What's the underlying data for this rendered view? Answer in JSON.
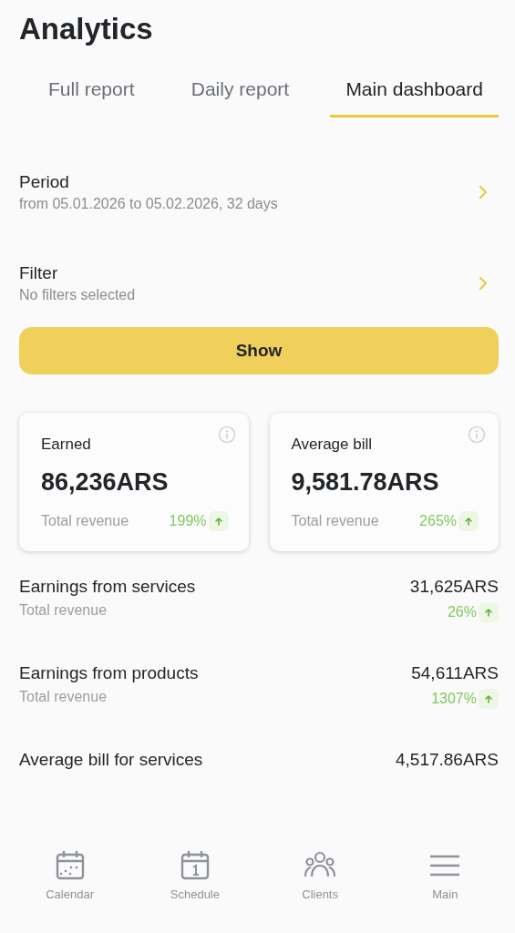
{
  "title": "Analytics",
  "tabs": [
    {
      "label": "Full report",
      "selected": false
    },
    {
      "label": "Daily report",
      "selected": false
    },
    {
      "label": "Main dashboard",
      "selected": true
    }
  ],
  "settings": [
    {
      "label": "Period",
      "value": "from 05.01.2026 to 05.02.2026, 32 days"
    },
    {
      "label": "Filter",
      "value": "No filters selected"
    }
  ],
  "show_button": "Show",
  "cards": [
    {
      "label": "Earned",
      "value": "86,236ARS",
      "caption": "Total revenue",
      "change": "199%"
    },
    {
      "label": "Average bill",
      "value": "9,581.78ARS",
      "caption": "Total revenue",
      "change": "265%"
    }
  ],
  "metrics": [
    {
      "label": "Earnings from services",
      "value": "31,625ARS",
      "caption": "Total revenue",
      "change": "26%"
    },
    {
      "label": "Earnings from products",
      "value": "54,611ARS",
      "caption": "Total revenue",
      "change": "1307%"
    },
    {
      "label": "Average bill for services",
      "value": "4,517.86ARS"
    }
  ],
  "nav": [
    {
      "label": "Calendar",
      "kind": "calendar"
    },
    {
      "label": "Schedule",
      "kind": "day"
    },
    {
      "label": "Clients",
      "kind": "people"
    },
    {
      "label": "Main",
      "kind": "menu"
    }
  ]
}
